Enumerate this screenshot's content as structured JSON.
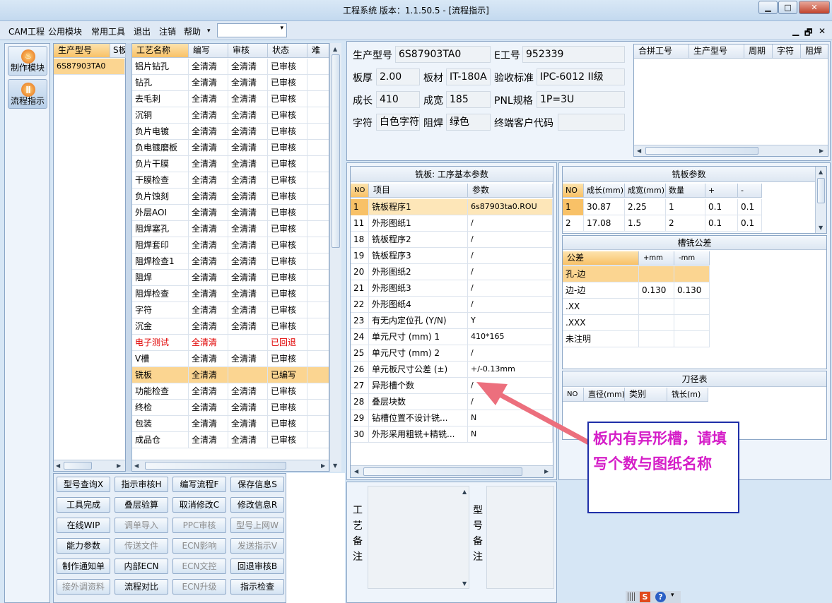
{
  "window": {
    "title": "工程系统  版本：1.1.50.5 - [流程指示]",
    "min": "▁",
    "max": "□",
    "close": "✕"
  },
  "menu": [
    "CAM工程",
    "公用模块",
    "常用工具",
    "退出",
    "注销",
    "帮助"
  ],
  "menu_dropdown_arrow": "▾",
  "combo_value": "",
  "mdi_controls": {
    "min": "▁",
    "restore": "🗗",
    "close": "✕"
  },
  "modules": [
    {
      "label": "制作模块",
      "icon": "flame-icon",
      "glyph": "♨"
    },
    {
      "label": "流程指示",
      "icon": "pause-icon",
      "glyph": "ǁ"
    }
  ],
  "model_list": {
    "headers": [
      "生产型号",
      "S板"
    ],
    "rows": [
      [
        "6S87903TA0",
        ""
      ]
    ]
  },
  "process_table": {
    "headers": [
      "工艺名称",
      "编写",
      "审核",
      "状态",
      "难"
    ],
    "rows": [
      {
        "name": "铝片钻孔",
        "write": "全清清",
        "review": "全清清",
        "status": "已审核",
        "red": false,
        "sel": false
      },
      {
        "name": "钻孔",
        "write": "全清清",
        "review": "全清清",
        "status": "已审核",
        "red": false,
        "sel": false
      },
      {
        "name": "去毛刺",
        "write": "全清清",
        "review": "全清清",
        "status": "已审核",
        "red": false,
        "sel": false
      },
      {
        "name": "沉铜",
        "write": "全清清",
        "review": "全清清",
        "status": "已审核",
        "red": false,
        "sel": false
      },
      {
        "name": "负片电镀",
        "write": "全清清",
        "review": "全清清",
        "status": "已审核",
        "red": false,
        "sel": false
      },
      {
        "name": "负电镀磨板",
        "write": "全清清",
        "review": "全清清",
        "status": "已审核",
        "red": false,
        "sel": false
      },
      {
        "name": "负片干膜",
        "write": "全清清",
        "review": "全清清",
        "status": "已审核",
        "red": false,
        "sel": false
      },
      {
        "name": "干膜检查",
        "write": "全清清",
        "review": "全清清",
        "status": "已审核",
        "red": false,
        "sel": false
      },
      {
        "name": "负片蚀刻",
        "write": "全清清",
        "review": "全清清",
        "status": "已审核",
        "red": false,
        "sel": false
      },
      {
        "name": "外层AOI",
        "write": "全清清",
        "review": "全清清",
        "status": "已审核",
        "red": false,
        "sel": false
      },
      {
        "name": "阻焊塞孔",
        "write": "全清清",
        "review": "全清清",
        "status": "已审核",
        "red": false,
        "sel": false
      },
      {
        "name": "阻焊套印",
        "write": "全清清",
        "review": "全清清",
        "status": "已审核",
        "red": false,
        "sel": false
      },
      {
        "name": "阻焊检查1",
        "write": "全清清",
        "review": "全清清",
        "status": "已审核",
        "red": false,
        "sel": false
      },
      {
        "name": "阻焊",
        "write": "全清清",
        "review": "全清清",
        "status": "已审核",
        "red": false,
        "sel": false
      },
      {
        "name": "阻焊检查",
        "write": "全清清",
        "review": "全清清",
        "status": "已审核",
        "red": false,
        "sel": false
      },
      {
        "name": "字符",
        "write": "全清清",
        "review": "全清清",
        "status": "已审核",
        "red": false,
        "sel": false
      },
      {
        "name": "沉金",
        "write": "全清清",
        "review": "全清清",
        "status": "已审核",
        "red": false,
        "sel": false
      },
      {
        "name": "电子测试",
        "write": "全清清",
        "review": "",
        "status": "已回退",
        "red": true,
        "sel": false
      },
      {
        "name": "V槽",
        "write": "全清清",
        "review": "全清清",
        "status": "已审核",
        "red": false,
        "sel": false
      },
      {
        "name": "铣板",
        "write": "全清清",
        "review": "",
        "status": "已编写",
        "red": false,
        "sel": true
      },
      {
        "name": "功能检查",
        "write": "全清清",
        "review": "全清清",
        "status": "已审核",
        "red": false,
        "sel": false
      },
      {
        "name": "终检",
        "write": "全清清",
        "review": "全清清",
        "status": "已审核",
        "red": false,
        "sel": false
      },
      {
        "name": "包装",
        "write": "全清清",
        "review": "全清清",
        "status": "已审核",
        "red": false,
        "sel": false
      },
      {
        "name": "成品仓",
        "write": "全清清",
        "review": "全清清",
        "status": "已审核",
        "red": false,
        "sel": false
      }
    ]
  },
  "buttons": [
    {
      "label": "型号查询X",
      "dis": false
    },
    {
      "label": "指示审核H",
      "dis": false
    },
    {
      "label": "编写流程F",
      "dis": false
    },
    {
      "label": "保存信息S",
      "dis": false
    },
    {
      "label": "工具完成",
      "dis": false
    },
    {
      "label": "叠层验算",
      "dis": false
    },
    {
      "label": "取消修改C",
      "dis": false
    },
    {
      "label": "修改信息R",
      "dis": false
    },
    {
      "label": "在线WIP",
      "dis": false
    },
    {
      "label": "调单导入",
      "dis": true
    },
    {
      "label": "PPC审核",
      "dis": true
    },
    {
      "label": "型号上网W",
      "dis": true
    },
    {
      "label": "能力参数",
      "dis": false
    },
    {
      "label": "传送文件",
      "dis": true
    },
    {
      "label": "ECN影响",
      "dis": true
    },
    {
      "label": "发送指示V",
      "dis": true
    },
    {
      "label": "制作通知单",
      "dis": false
    },
    {
      "label": "内部ECN",
      "dis": false
    },
    {
      "label": "ECN文控",
      "dis": true
    },
    {
      "label": "回退审核B",
      "dis": false
    },
    {
      "label": "接外调资料",
      "dis": true
    },
    {
      "label": "流程对比",
      "dis": false
    },
    {
      "label": "ECN升级",
      "dis": true
    },
    {
      "label": "指示检查",
      "dis": false
    }
  ],
  "info": {
    "model_label": "生产型号",
    "model": "6S87903TA0",
    "eng_label": "E工号",
    "eng": "952339",
    "thick_label": "板厚",
    "thick": "2.00",
    "mat_label": "板材",
    "mat": "IT-180A",
    "std_label": "验收标准",
    "std": "IPC-6012 II级",
    "len_label": "成长",
    "len": "410",
    "wid_label": "成宽",
    "wid": "185",
    "pnl_label": "PNL规格",
    "pnl": "1P=3U",
    "char_label": "字符",
    "char": "白色字符",
    "mask_label": "阻焊",
    "mask": "绿色",
    "cust_label": "终端客户代码",
    "cust": ""
  },
  "combine_table": {
    "headers": [
      "合拼工号",
      "生产型号",
      "周期",
      "字符",
      "阻焊"
    ]
  },
  "params": {
    "title": "铣板: 工序基本参数",
    "headers": [
      "NO",
      "项目",
      "参数"
    ],
    "rows": [
      [
        "1",
        "铣板程序1",
        "6s87903ta0.ROU"
      ],
      [
        "11",
        "外形图纸1",
        "/"
      ],
      [
        "18",
        "铣板程序2",
        "/"
      ],
      [
        "19",
        "铣板程序3",
        "/"
      ],
      [
        "20",
        "外形图纸2",
        "/"
      ],
      [
        "21",
        "外形图纸3",
        "/"
      ],
      [
        "22",
        "外形图纸4",
        "/"
      ],
      [
        "23",
        "有无内定位孔 (Y/N)",
        "Y"
      ],
      [
        "24",
        "单元尺寸 (mm) 1",
        "410*165"
      ],
      [
        "25",
        "单元尺寸 (mm) 2",
        "/"
      ],
      [
        "26",
        "单元板尺寸公差 (±)",
        "+/-0.13mm"
      ],
      [
        "27",
        "异形槽个数",
        "/"
      ],
      [
        "28",
        "叠层块数",
        "/"
      ],
      [
        "29",
        "钻槽位置不设计铣...",
        "N"
      ],
      [
        "30",
        "外形采用粗铣+精铣...",
        "N"
      ]
    ]
  },
  "mill": {
    "title": "铣板参数",
    "headers": [
      "NO",
      "成长(mm)",
      "成宽(mm)",
      "数量",
      "+",
      "-"
    ],
    "rows": [
      [
        "1",
        "30.87",
        "2.25",
        "1",
        "0.1",
        "0.1"
      ],
      [
        "2",
        "17.08",
        "1.5",
        "2",
        "0.1",
        "0.1"
      ]
    ]
  },
  "tolerance": {
    "title": "槽铣公差",
    "headers": [
      "公差",
      "+mm",
      "-mm"
    ],
    "rows": [
      [
        "孔-边",
        "",
        ""
      ],
      [
        "边-边",
        "0.130",
        "0.130"
      ],
      [
        ".XX",
        "",
        ""
      ],
      [
        ".XXX",
        "",
        ""
      ],
      [
        "未注明",
        "",
        ""
      ]
    ]
  },
  "tools": {
    "title": "刀径表",
    "headers": [
      "NO",
      "直径(mm)",
      "类别",
      "铣长(m)"
    ]
  },
  "remarks": {
    "process": "工艺备注",
    "model": "型号备注"
  },
  "callout": "板内有异形槽，请填写个数与图纸名称",
  "taskbar": {
    "s": "S",
    "q": "?"
  },
  "colors": {
    "selected_row": "#fbd591",
    "red_text": "#e00000",
    "callout_text": "#d51ec8",
    "callout_border": "#1f2fa8",
    "arrow": "#ec6f7d"
  }
}
